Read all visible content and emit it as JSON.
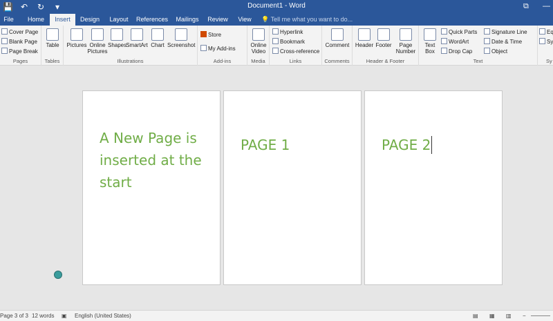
{
  "window": {
    "title": "Document1 - Word",
    "quick_access": {
      "save": "💾",
      "undo": "↶",
      "redo": "↻",
      "customize": "▾"
    },
    "controls": {
      "ribbon_options": "⧉",
      "minimize": "—"
    }
  },
  "tabs": [
    "File",
    "Home",
    "Insert",
    "Design",
    "Layout",
    "References",
    "Mailings",
    "Review",
    "View"
  ],
  "tell_me": "Tell me what you want to do...",
  "ribbon": {
    "pages": {
      "label": "Pages",
      "cover_page": "Cover Page",
      "blank_page": "Blank Page",
      "page_break": "Page Break"
    },
    "tables": {
      "label": "Tables",
      "table": "Table"
    },
    "illustrations": {
      "label": "Illustrations",
      "pictures": "Pictures",
      "online_pictures_1": "Online",
      "online_pictures_2": "Pictures",
      "shapes": "Shapes",
      "smartart": "SmartArt",
      "chart": "Chart",
      "screenshot": "Screenshot"
    },
    "addins": {
      "label": "Add-ins",
      "store": "Store",
      "my_addins": "My Add-ins"
    },
    "media": {
      "label": "Media",
      "online_video_1": "Online",
      "online_video_2": "Video"
    },
    "links": {
      "label": "Links",
      "hyperlink": "Hyperlink",
      "bookmark": "Bookmark",
      "cross_reference": "Cross-reference"
    },
    "comments": {
      "label": "Comments",
      "comment": "Comment"
    },
    "header_footer": {
      "label": "Header & Footer",
      "header": "Header",
      "footer": "Footer",
      "page_number_1": "Page",
      "page_number_2": "Number"
    },
    "text": {
      "label": "Text",
      "text_box_1": "Text",
      "text_box_2": "Box",
      "quick_parts": "Quick Parts",
      "wordart": "WordArt",
      "drop_cap": "Drop Cap",
      "signature_line": "Signature Line",
      "date_time": "Date & Time",
      "object": "Object"
    },
    "symbols": {
      "label": "Sy",
      "equation": "Eq",
      "symbol": "Sy"
    }
  },
  "document": {
    "pages": [
      {
        "text": "A New Page is inserted at the start"
      },
      {
        "text": "PAGE 1"
      },
      {
        "text": "PAGE 2"
      }
    ],
    "text_color": "#70ad47"
  },
  "status": {
    "page": "Page 3 of 3",
    "words": "12 words",
    "language": "English (United States)",
    "zoom_out": "−",
    "zoom_in": "+"
  }
}
